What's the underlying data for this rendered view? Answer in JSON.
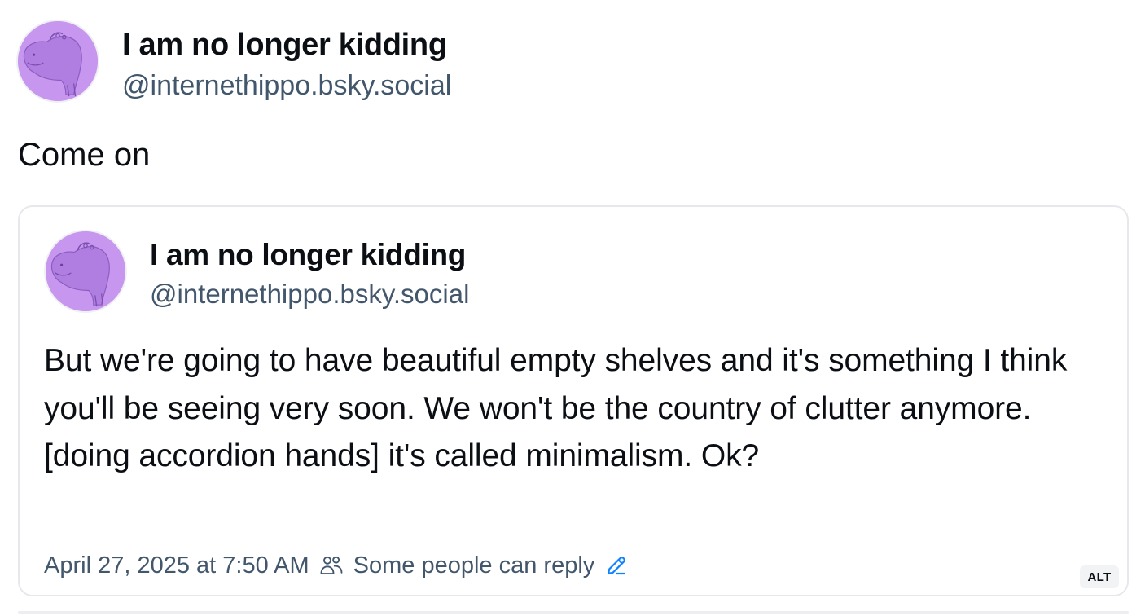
{
  "post": {
    "author": {
      "display_name": "I am no longer kidding",
      "handle": "@internethippo.bsky.social",
      "avatar_icon": "hippo-avatar-icon"
    },
    "text": "Come on",
    "quote": {
      "author": {
        "display_name": "I am no longer kidding",
        "handle": "@internethippo.bsky.social",
        "avatar_icon": "hippo-avatar-icon"
      },
      "text": "But we're going to have beautiful empty shelves and it's something I think you'll be seeing very soon. We won't be the country of clutter anymore. [doing accordion hands] it's called minimalism. Ok?",
      "timestamp": "April 27, 2025 at 7:50 AM",
      "reply_setting": "Some people can reply",
      "reply_icon": "people-icon",
      "edit_icon": "pencil-icon",
      "alt_badge": "ALT"
    }
  },
  "colors": {
    "avatar_purple": "#c796ee",
    "text_primary": "#0b0f14",
    "text_secondary": "#42576c",
    "link_blue": "#1083fe",
    "card_border": "#e6e8ec"
  }
}
